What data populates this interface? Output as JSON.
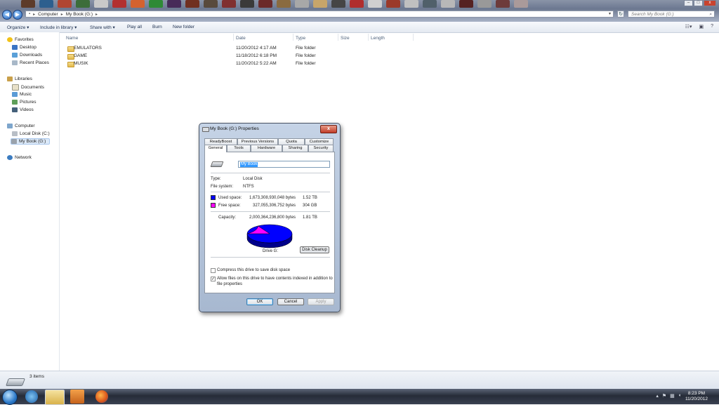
{
  "address": {
    "segments": [
      "Computer",
      "My Book (G:)"
    ]
  },
  "search": {
    "placeholder": "Search My Book (G:)"
  },
  "window_controls": {
    "minimize": "–",
    "maximize": "□",
    "close": "x"
  },
  "toolbar": {
    "organize": "Organize ▾",
    "include_in_library": "Include in library ▾",
    "share_with": "Share with ▾",
    "play_all": "Play all",
    "burn": "Burn",
    "new_folder": "New folder"
  },
  "nav": {
    "favorites": "Favorites",
    "desktop": "Desktop",
    "downloads": "Downloads",
    "recent_places": "Recent Places",
    "libraries": "Libraries",
    "documents": "Documents",
    "music": "Music",
    "pictures": "Pictures",
    "videos": "Videos",
    "computer": "Computer",
    "local_disk": "Local Disk (C:)",
    "my_book": "My Book (G:)",
    "network": "Network"
  },
  "columns": {
    "name": "Name",
    "date": "Date",
    "type": "Type",
    "size": "Size",
    "length": "Length"
  },
  "files": [
    {
      "name": "EMULATORS",
      "date": "11/20/2012 4:17 AM",
      "type": "File folder"
    },
    {
      "name": "GAME",
      "date": "11/18/2012 6:18 PM",
      "type": "File folder"
    },
    {
      "name": "MUSIK",
      "date": "11/20/2012 5:22 AM",
      "type": "File folder"
    }
  ],
  "status": {
    "items": "3 items"
  },
  "clock": {
    "time": "8:23 PM",
    "date": "11/20/2012"
  },
  "dialog": {
    "title": "My Book (G:) Properties",
    "close": "x",
    "tabs_top": [
      "ReadyBoost",
      "Previous Versions",
      "Quota",
      "Customize"
    ],
    "tabs_bottom": [
      "General",
      "Tools",
      "Hardware",
      "Sharing",
      "Security"
    ],
    "drive_name": "My Book",
    "type_label": "Type:",
    "type_value": "Local Disk",
    "fs_label": "File system:",
    "fs_value": "NTFS",
    "used_label": "Used space:",
    "used_bytes": "1,673,308,930,048 bytes",
    "used_size": "1.52 TB",
    "free_label": "Free space:",
    "free_bytes": "327,055,306,752 bytes",
    "free_size": "304 GB",
    "capacity_label": "Capacity:",
    "capacity_bytes": "2,000,364,236,800 bytes",
    "capacity_size": "1.81 TB",
    "drive_label": "Drive G:",
    "disk_cleanup": "Disk Cleanup",
    "compress": "Compress this drive to save disk space",
    "index_line1": "Allow files on this drive to have contents indexed in addition to",
    "index_line2": "file properties",
    "ok": "OK",
    "cancel": "Cancel",
    "apply": "Apply",
    "used_fraction": 0.8365,
    "used_color": "#0000ff",
    "free_color": "#ff00ff"
  },
  "colors": {
    "used": "#0000ff",
    "free": "#ff00ff"
  }
}
